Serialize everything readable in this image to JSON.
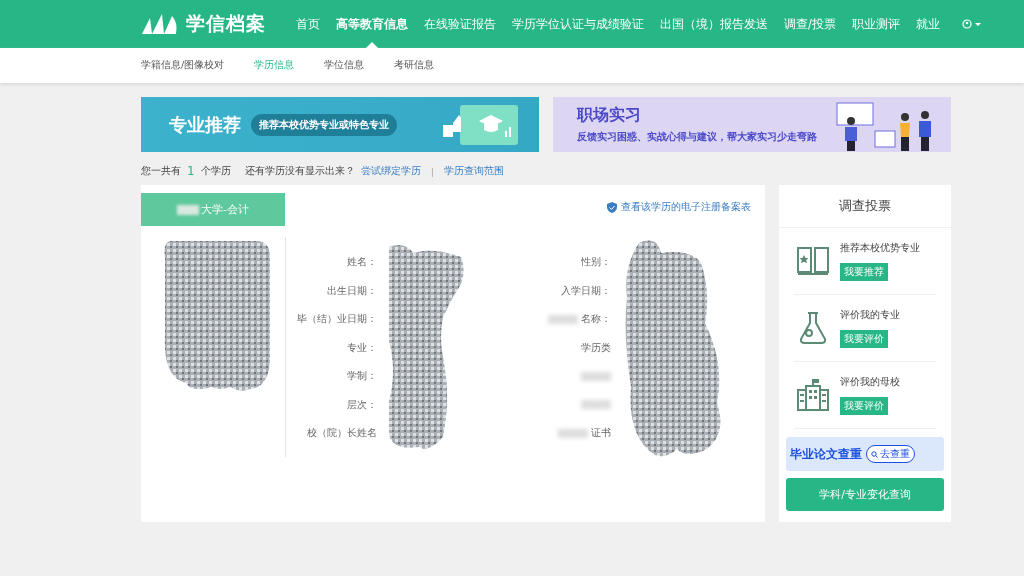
{
  "header": {
    "logo": "学信档案",
    "nav": [
      {
        "label": "首页",
        "selected": false
      },
      {
        "label": "高等教育信息",
        "selected": true
      },
      {
        "label": "在线验证报告",
        "selected": false
      },
      {
        "label": "学历学位认证与成绩验证",
        "selected": false
      },
      {
        "label": "出国（境）报告发送",
        "selected": false
      },
      {
        "label": "调查/投票",
        "selected": false
      },
      {
        "label": "职业测评",
        "selected": false
      },
      {
        "label": "就业",
        "selected": false
      }
    ]
  },
  "subnav": [
    {
      "label": "学籍信息/图像校对",
      "selected": false
    },
    {
      "label": "学历信息",
      "selected": true
    },
    {
      "label": "学位信息",
      "selected": false
    },
    {
      "label": "考研信息",
      "selected": false
    }
  ],
  "banners": [
    {
      "kind": "major",
      "title": "专业推荐",
      "tag": "推荐本校优势专业或特色专业"
    },
    {
      "kind": "intern",
      "title": "职场实习",
      "subtitle": "反馈实习困惑、实战心得与建议，帮大家实习少走弯路"
    }
  ],
  "summary": {
    "prefix": "您一共有",
    "count": "1",
    "suffix": "个学历",
    "question": "还有学历没有显示出来？",
    "link1": "尝试绑定学历",
    "separator": "|",
    "link2": "学历查询范围"
  },
  "record": {
    "title": "大学-会计",
    "registry_link": "查看该学历的电子注册备案表",
    "left_labels": [
      "姓名：",
      "出生日期：",
      "毕（结）业日期：",
      "专业：",
      "学制：",
      "层次：",
      "校（院）长姓名"
    ],
    "right_labels": [
      {
        "text": "性别：",
        "blurred": false
      },
      {
        "text": "入学日期：",
        "blurred": false
      },
      {
        "text": "名称：",
        "blurred": true
      },
      {
        "text": "学历类",
        "blurred": false
      },
      {
        "blurred": true
      },
      {
        "blurred": true
      },
      {
        "text": "证书",
        "blurred": true
      }
    ]
  },
  "survey": {
    "title": "调查投票",
    "items": [
      {
        "kind": "book",
        "label": "推荐本校优势专业",
        "button": "我要推荐"
      },
      {
        "kind": "flask",
        "label": "评价我的专业",
        "button": "我要评价"
      },
      {
        "kind": "building",
        "label": "评价我的母校",
        "button": "我要评价"
      }
    ],
    "thesis_banner": {
      "title": "毕业论文查重",
      "button": "去查重"
    },
    "query_button": "学科/专业变化查询"
  }
}
